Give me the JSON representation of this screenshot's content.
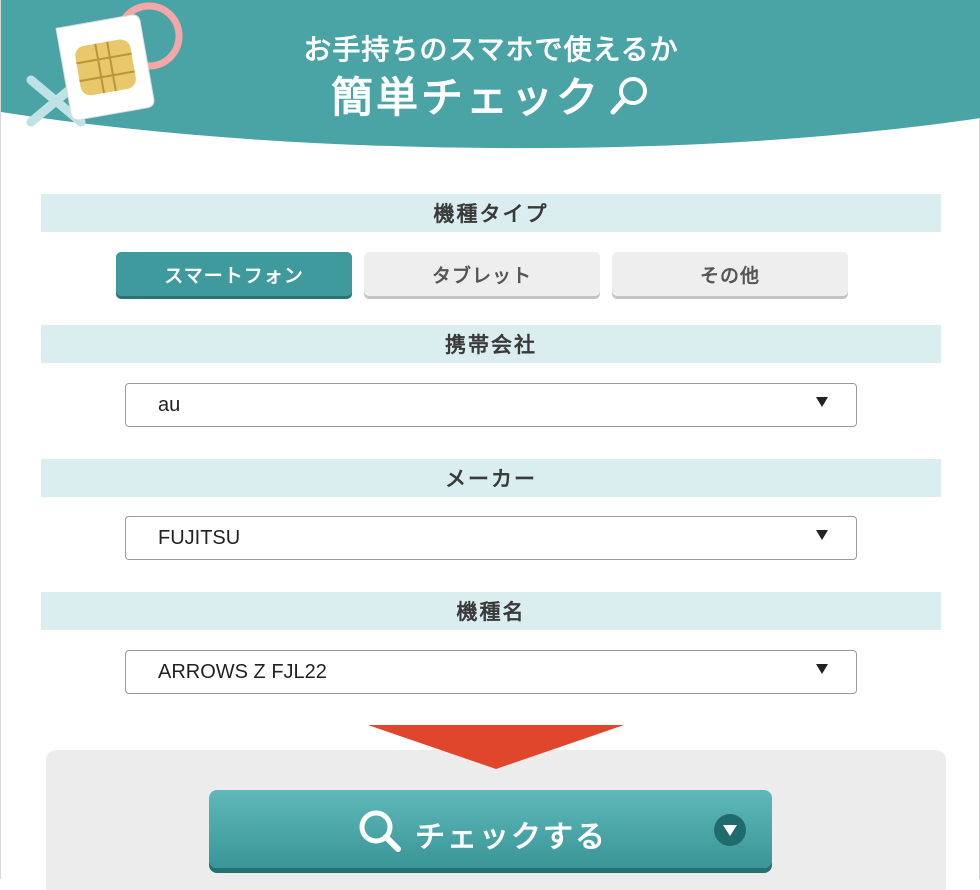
{
  "header": {
    "subtitle": "お手持ちのスマホで使えるか",
    "title": "簡単チェック"
  },
  "device_type": {
    "heading": "機種タイプ",
    "options": [
      "スマートフォン",
      "タブレット",
      "その他"
    ],
    "selected": "スマートフォン"
  },
  "carrier": {
    "heading": "携帯会社",
    "value": "au"
  },
  "maker": {
    "heading": "メーカー",
    "value": "FUJITSU"
  },
  "model": {
    "heading": "機種名",
    "value": "ARROWS Z FJL22"
  },
  "check_button": {
    "label": "チェックする"
  },
  "colors": {
    "teal": "#3e9a9c",
    "teal_light": "#daeef0",
    "arrow_red": "#e0462b",
    "pink": "#f3a7a9"
  },
  "icons": [
    "sim-card-icon",
    "magnify-icon",
    "search-icon",
    "chevron-down-icon"
  ]
}
